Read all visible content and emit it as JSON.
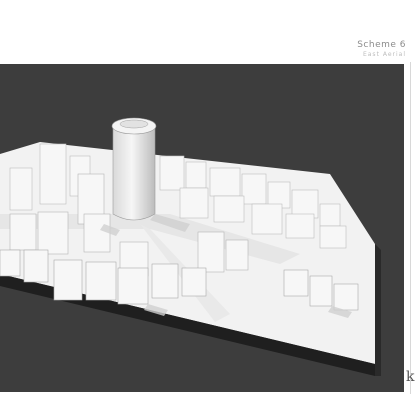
{
  "sheet": {
    "title": "Scheme 6",
    "subtitle": "East Aerial",
    "logo_glyph": "k"
  },
  "colors": {
    "background": "#3d3d3d",
    "model_base": "#f2f2f2",
    "building_light": "#f7f7f7",
    "building_shade": "#cfcfcf",
    "tower": "#e9e9e9"
  }
}
